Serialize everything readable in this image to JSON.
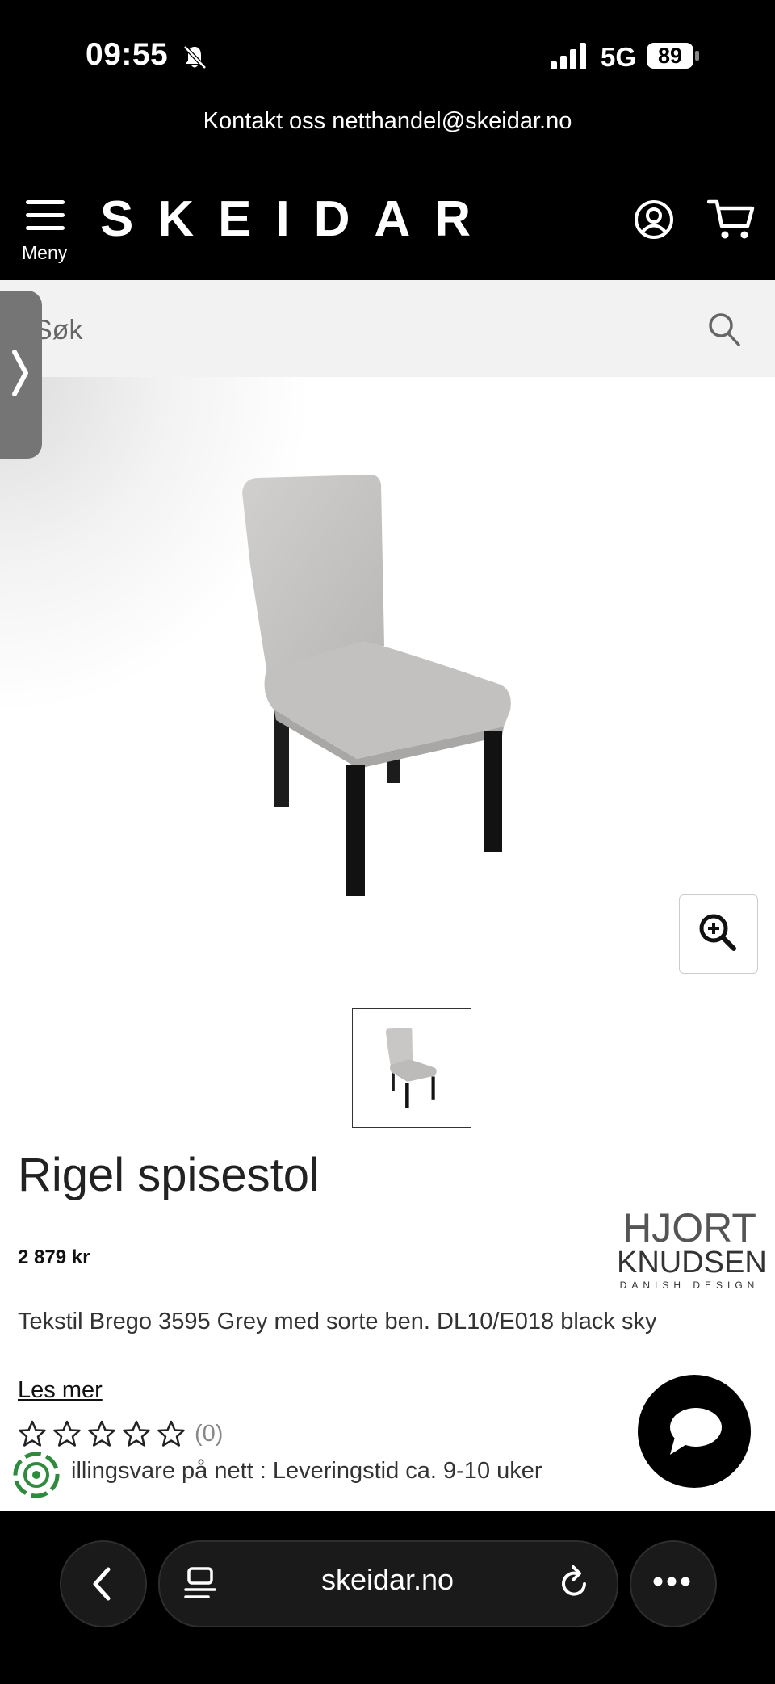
{
  "status_bar": {
    "time": "09:55",
    "network": "5G",
    "battery": "89",
    "icons": [
      "bell-muted-icon",
      "signal-icon",
      "battery-icon"
    ]
  },
  "contact_bar": {
    "text": "Kontakt oss netthandel@skeidar.no"
  },
  "header": {
    "menu_label": "Meny",
    "logo": "SKEIDAR",
    "icons": [
      "hamburger-menu-icon",
      "account-icon",
      "cart-icon"
    ]
  },
  "search": {
    "placeholder": "Søk",
    "icon": "search-icon"
  },
  "product": {
    "title": "Rigel spisestol",
    "price": "2 879 kr",
    "brand": {
      "line1": "HJORT",
      "line2": "KNUDSEN",
      "line3": "DANISH DESIGN"
    },
    "description": "Tekstil Brego 3595 Grey med sorte ben. DL10/E018 black sky",
    "read_more": "Les mer",
    "rating": {
      "stars": 5,
      "filled": 0,
      "count": "(0)"
    },
    "delivery": "illingsvare på nett : Leveringstid ca. 9-10 uker"
  },
  "browser": {
    "url": "skeidar.no",
    "icons": [
      "back-icon",
      "tabs-icon",
      "reload-icon",
      "more-icon"
    ]
  },
  "colors": {
    "header_bg": "#000000",
    "search_bg": "#f2f2f2",
    "chair_fabric": "#c9c7c5",
    "chair_legs": "#1c1c1c",
    "delivery_green": "#2e8b3d"
  }
}
